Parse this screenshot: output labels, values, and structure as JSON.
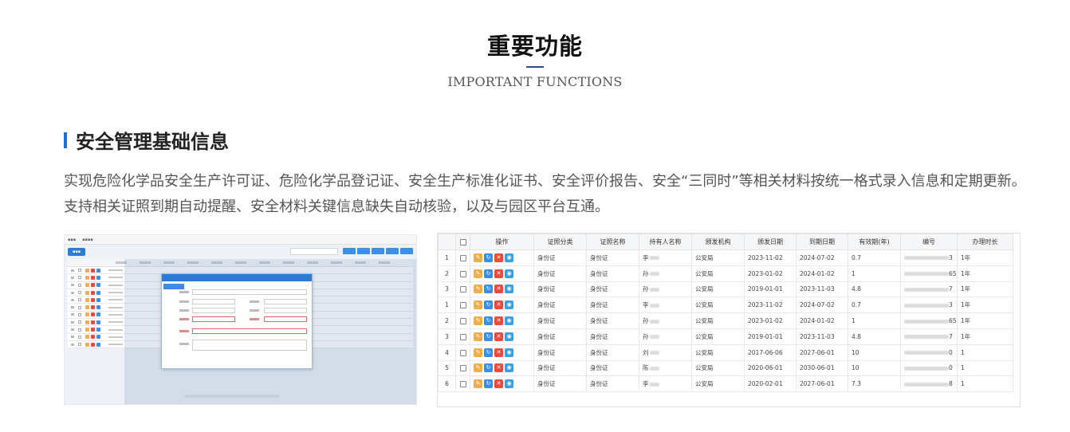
{
  "header": {
    "title": "重要功能",
    "subtitle": "IMPORTANT FUNCTIONS"
  },
  "section": {
    "title": "安全管理基础信息",
    "description": "实现危险化学品安全生产许可证、危险化学品登记证、安全生产标准化证书、安全评价报告、安全“三同时”等相关材料按统一格式录入信息和定期更新。支持相关证照到期自动提醒、安全材料关键信息缺失自动核验，以及与园区平台互通。"
  },
  "icons": {
    "edit": "edit-icon",
    "refresh": "refresh-icon",
    "delete": "delete-icon",
    "view": "view-icon"
  },
  "table": {
    "columns": [
      "操作",
      "证照分类",
      "证照名称",
      "持有人名称",
      "颁发机构",
      "颁发日期",
      "到期日期",
      "有效期(年)",
      "编号",
      "办理时长"
    ],
    "rows": [
      {
        "no": "1",
        "category": "身份证",
        "name": "身份证",
        "holder": "李",
        "org": "公安局",
        "issue": "2023-11-02",
        "expire": "2024-07-02",
        "years": "0.7",
        "code_tail": "3",
        "duration": "1年"
      },
      {
        "no": "2",
        "category": "身份证",
        "name": "身份证",
        "holder": "孙",
        "org": "公安局",
        "issue": "2023-01-02",
        "expire": "2024-01-02",
        "years": "1",
        "code_tail": "65",
        "duration": "1年"
      },
      {
        "no": "3",
        "category": "身份证",
        "name": "身份证",
        "holder": "孙",
        "org": "公安局",
        "issue": "2019-01-01",
        "expire": "2023-11-03",
        "years": "4.8",
        "code_tail": "7",
        "duration": "1年"
      },
      {
        "no": "1",
        "category": "身份证",
        "name": "身份证",
        "holder": "李",
        "org": "公安局",
        "issue": "2023-11-02",
        "expire": "2024-07-02",
        "years": "0.7",
        "code_tail": "3",
        "duration": "1年"
      },
      {
        "no": "2",
        "category": "身份证",
        "name": "身份证",
        "holder": "孙",
        "org": "公安局",
        "issue": "2023-01-02",
        "expire": "2024-01-02",
        "years": "1",
        "code_tail": "65",
        "duration": "1年"
      },
      {
        "no": "3",
        "category": "身份证",
        "name": "身份证",
        "holder": "孙",
        "org": "公安局",
        "issue": "2019-01-01",
        "expire": "2023-11-03",
        "years": "4.8",
        "code_tail": "7",
        "duration": "1年"
      },
      {
        "no": "4",
        "category": "身份证",
        "name": "身份证",
        "holder": "刘",
        "org": "公安局",
        "issue": "2017-06-06",
        "expire": "2027-06-01",
        "years": "10",
        "code_tail": "0",
        "duration": "1"
      },
      {
        "no": "5",
        "category": "身份证",
        "name": "身份证",
        "holder": "陈",
        "org": "公安局",
        "issue": "2020-06-01",
        "expire": "2030-06-01",
        "years": "10",
        "code_tail": "0",
        "duration": "1"
      },
      {
        "no": "6",
        "category": "身份证",
        "name": "身份证",
        "holder": "李",
        "org": "公安局",
        "issue": "2020-02-01",
        "expire": "2027-06-01",
        "years": "7.3",
        "code_tail": "8",
        "duration": "1"
      }
    ]
  }
}
